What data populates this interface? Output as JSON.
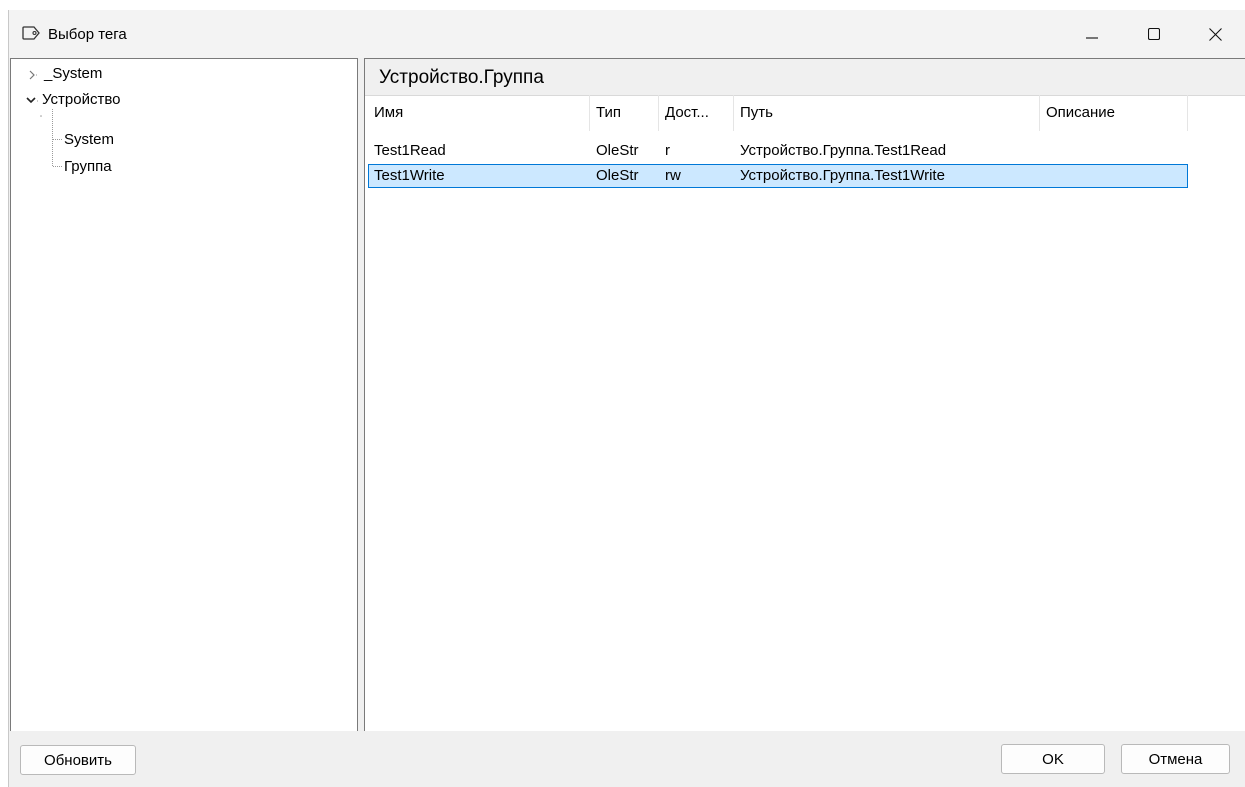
{
  "window": {
    "title": "Выбор тега",
    "icon": "tag-icon"
  },
  "tree": {
    "items": [
      {
        "label": "_System",
        "state": "collapsed"
      },
      {
        "label": "Устройство",
        "state": "expanded"
      },
      {
        "label": "System",
        "state": "leaf"
      },
      {
        "label": "Группа",
        "state": "leaf"
      }
    ]
  },
  "content": {
    "header": "Устройство.Группа",
    "columns": [
      "Имя",
      "Тип",
      "Дост...",
      "Путь",
      "Описание"
    ],
    "rows": [
      {
        "name": "Test1Read",
        "type": "OleStr",
        "access": "r",
        "path": "Устройство.Группа.Test1Read",
        "description": ""
      },
      {
        "name": "Test1Write",
        "type": "OleStr",
        "access": "rw",
        "path": "Устройство.Группа.Test1Write",
        "description": "",
        "selected": true
      }
    ]
  },
  "buttons": {
    "refresh": "Обновить",
    "ok": "OK",
    "cancel": "Отмена"
  },
  "colors": {
    "selection_bg": "#cce8ff",
    "selection_border": "#0078d7"
  }
}
